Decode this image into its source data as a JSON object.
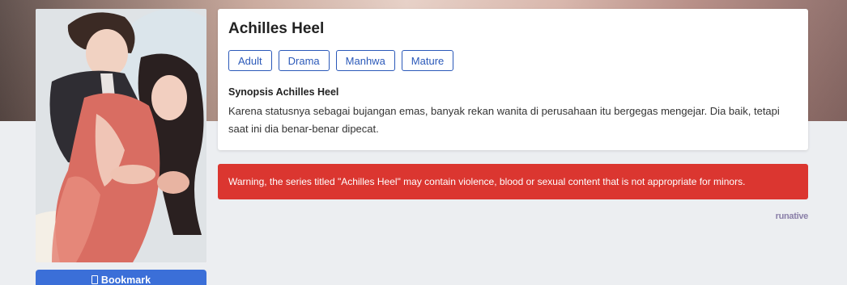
{
  "series": {
    "title": "Achilles Heel",
    "genres": [
      "Adult",
      "Drama",
      "Manhwa",
      "Mature"
    ],
    "synopsis_title": "Synopsis Achilles Heel",
    "synopsis": "Karena statusnya sebagai bujangan emas, banyak rekan wanita di perusahaan itu bergegas mengejar. Dia baik, tetapi saat ini dia benar-benar dipecat."
  },
  "bookmark": {
    "label": "Bookmark",
    "icon": "bookmark-icon"
  },
  "warning": {
    "text": "Warning, the series titled \"Achilles Heel\" may contain violence, blood or sexual content that is not appropriate for minors."
  },
  "ad": {
    "logo_text": "runative"
  },
  "colors": {
    "accent": "#2b59b9",
    "bookmark_bg": "#3b6fd8",
    "warning_bg": "#db3630",
    "page_bg": "#eceef1"
  }
}
